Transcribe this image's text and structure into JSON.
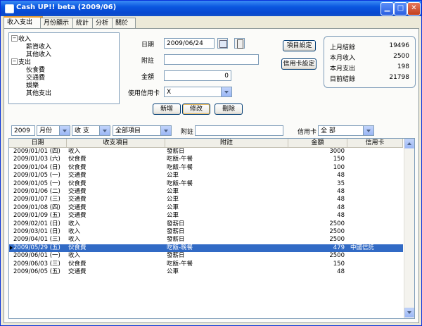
{
  "window": {
    "title": "Cash UP!! beta (2009/06)"
  },
  "tabs": [
    {
      "label": "收入支出"
    },
    {
      "label": "月份顯示"
    },
    {
      "label": "統計"
    },
    {
      "label": "分析"
    },
    {
      "label": "關於"
    }
  ],
  "tree": {
    "income": {
      "label": "收入",
      "children": [
        "薪資收入",
        "其他收入"
      ]
    },
    "expense": {
      "label": "支出",
      "children": [
        "伙食費",
        "交通費",
        "娛樂",
        "其他支出"
      ]
    }
  },
  "form": {
    "date_label": "日期",
    "date_value": "2009/06/24",
    "note_label": "附註",
    "note_value": "",
    "amount_label": "金額",
    "amount_value": "0",
    "credit_label": "使用信用卡",
    "credit_value": "X",
    "add_button": "新增",
    "edit_button": "修改",
    "delete_button": "刪除",
    "item_settings_button": "項目設定",
    "card_settings_button": "信用卡設定"
  },
  "summary": {
    "rows": [
      {
        "label": "上月結餘",
        "value": "19496"
      },
      {
        "label": "本月收入",
        "value": "2500"
      },
      {
        "label": "本月支出",
        "value": "198"
      },
      {
        "label": "目前結餘",
        "value": "21798"
      }
    ]
  },
  "filter": {
    "year": "2009",
    "period": "月份",
    "type": "收 支",
    "category": "全部項目",
    "note_label": "附註",
    "note_value": "",
    "card_label": "信用卡",
    "card_value": "全 部"
  },
  "table": {
    "columns": [
      "日期",
      "收支項目",
      "附註",
      "金額",
      "信用卡"
    ],
    "selected_index": 13,
    "rows": [
      [
        "2009/01/01 (四)",
        "收入",
        "發薪日",
        "3000",
        ""
      ],
      [
        "2009/01/03 (六)",
        "伙食費",
        "吃飯-午餐",
        "150",
        ""
      ],
      [
        "2009/01/04 (日)",
        "伙食費",
        "吃飯-午餐",
        "100",
        ""
      ],
      [
        "2009/01/05 (一)",
        "交通費",
        "公車",
        "48",
        ""
      ],
      [
        "2009/01/05 (一)",
        "伙食費",
        "吃飯-午餐",
        "35",
        ""
      ],
      [
        "2009/01/06 (二)",
        "交通費",
        "公車",
        "48",
        ""
      ],
      [
        "2009/01/07 (三)",
        "交通費",
        "公車",
        "48",
        ""
      ],
      [
        "2009/01/08 (四)",
        "交通費",
        "公車",
        "48",
        ""
      ],
      [
        "2009/01/09 (五)",
        "交通費",
        "公車",
        "48",
        ""
      ],
      [
        "2009/02/01 (日)",
        "收入",
        "發薪日",
        "2500",
        ""
      ],
      [
        "2009/03/01 (日)",
        "收入",
        "發薪日",
        "2500",
        ""
      ],
      [
        "2009/04/01 (三)",
        "收入",
        "發薪日",
        "2500",
        ""
      ],
      [
        "2009/05/29 (五)",
        "伙食費",
        "吃飯-晚餐",
        "479",
        "中國信託"
      ],
      [
        "2009/06/01 (一)",
        "收入",
        "發薪日",
        "2500",
        ""
      ],
      [
        "2009/06/03 (三)",
        "伙食費",
        "吃飯-午餐",
        "150",
        ""
      ],
      [
        "2009/06/05 (五)",
        "交通費",
        "公車",
        "48",
        ""
      ]
    ]
  },
  "colors": {
    "title_bar": "#0a56df",
    "selection": "#316ac5",
    "tab_highlight": "#f0a030"
  }
}
